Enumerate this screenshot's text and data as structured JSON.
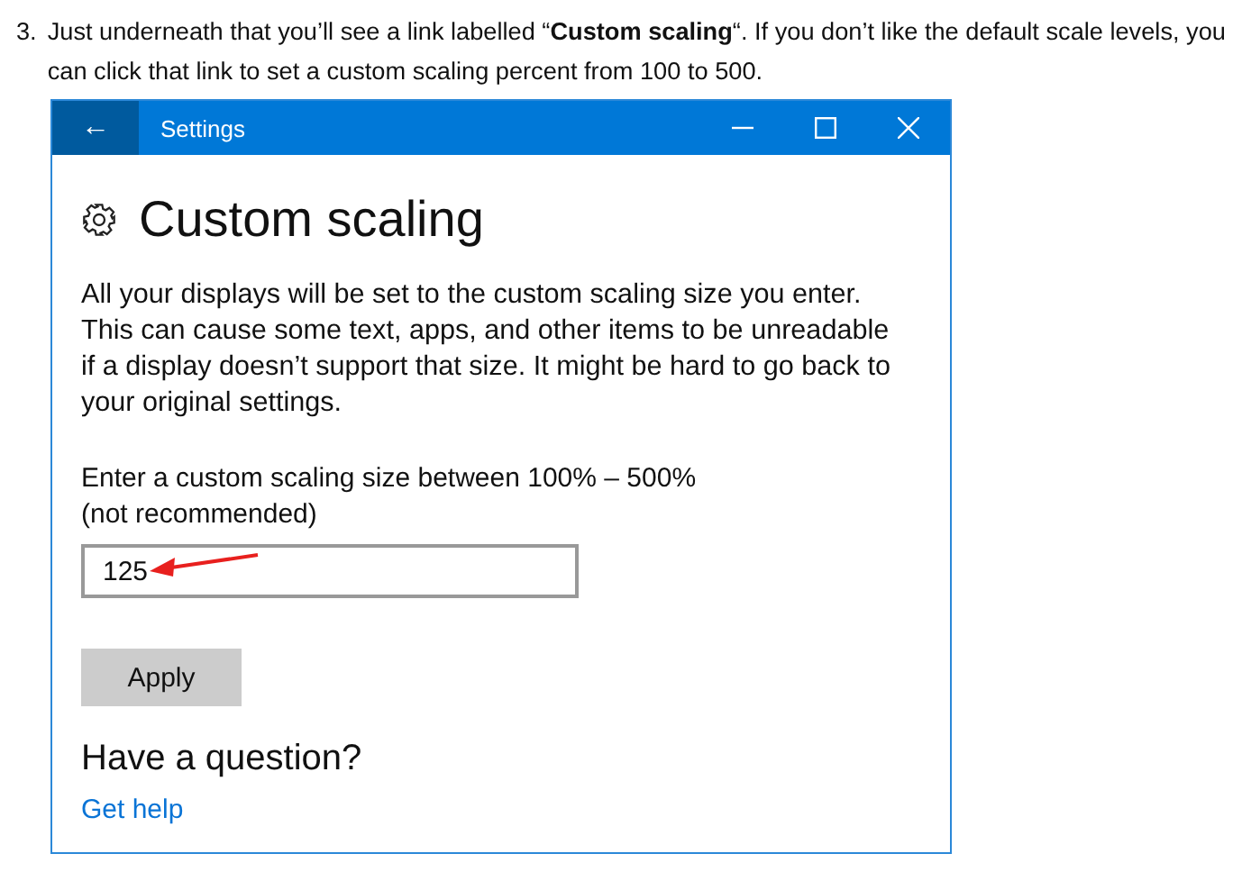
{
  "step": {
    "number": "3.",
    "text": "Just underneath that you’ll see a link labelled “**Custom scaling**“. If you don’t like the default scale levels, you can click that link to set a custom scaling percent from 100 to 500."
  },
  "window": {
    "back_glyph": "←",
    "title": "Settings",
    "controls": [
      {
        "kind": "minimize"
      },
      {
        "kind": "maximize"
      },
      {
        "kind": "close"
      }
    ]
  },
  "page": {
    "heading": "Custom scaling",
    "description": "All your displays will be set to the custom scaling size you enter. This can cause some text, apps, and other items to be unreadable if a display doesn’t support that size. It might be hard to go back to your original settings.",
    "field_label": "Enter a custom scaling size between 100% – 500% (not recommended)",
    "field_value": "125",
    "apply_button": "Apply",
    "help_heading": "Have a question?",
    "help_link": "Get help"
  }
}
